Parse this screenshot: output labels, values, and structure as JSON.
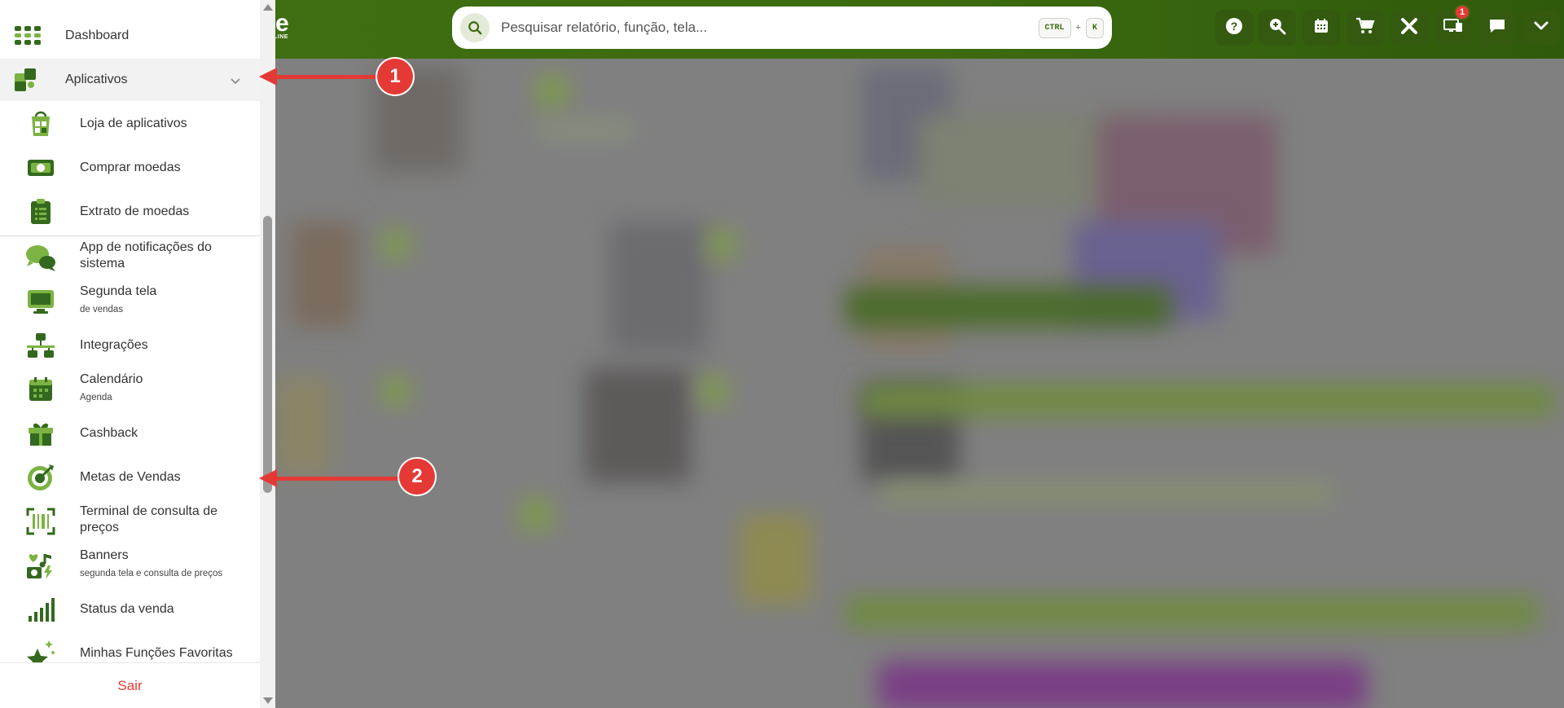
{
  "brand": {
    "logo_letter": "e",
    "logo_sub": "LINE",
    "accent": "#3c6b10",
    "icon_green": "#7cb342",
    "icon_dark": "#33691e",
    "danger": "#e53935"
  },
  "search": {
    "placeholder": "Pesquisar relatório, função, tela...",
    "shortcut_ctrl": "CTRL",
    "shortcut_plus": "+",
    "shortcut_key": "K"
  },
  "topbar_icons": [
    {
      "name": "help-icon"
    },
    {
      "name": "zoom-in-icon"
    },
    {
      "name": "calendar-icon"
    },
    {
      "name": "cart-icon"
    },
    {
      "name": "tools-icon"
    },
    {
      "name": "second-screen-icon",
      "badge": "1"
    },
    {
      "name": "chat-icon"
    },
    {
      "name": "chevron-down-icon"
    }
  ],
  "sidebar": {
    "items": [
      {
        "label": "Dashboard",
        "icon": "grid-icon"
      },
      {
        "label": "Aplicativos",
        "icon": "puzzle-icon",
        "expanded": true
      },
      {
        "label": "Loja de aplicativos",
        "icon": "app-store-icon"
      },
      {
        "label": "Comprar moedas",
        "icon": "money-icon"
      },
      {
        "label": "Extrato de moedas",
        "icon": "clipboard-icon"
      },
      {
        "label": "App de notificações do sistema",
        "icon": "chat-bubbles-icon"
      },
      {
        "label": "Segunda tela",
        "sub": "de vendas",
        "icon": "monitor-icon"
      },
      {
        "label": "Integrações",
        "icon": "network-icon"
      },
      {
        "label": "Calendário",
        "sub": "Agenda",
        "icon": "calendar-icon"
      },
      {
        "label": "Cashback",
        "icon": "gift-icon"
      },
      {
        "label": "Metas de Vendas",
        "icon": "target-icon"
      },
      {
        "label": "Terminal de consulta de preços",
        "icon": "barcode-icon"
      },
      {
        "label": "Banners",
        "sub": "segunda tela e consulta de preços",
        "icon": "media-icon"
      },
      {
        "label": "Status da venda",
        "icon": "signal-bars-icon"
      },
      {
        "label": "Minhas Funções Favoritas",
        "icon": "stars-icon"
      }
    ],
    "logout_label": "Sair"
  },
  "annotations": {
    "marker_1": "1",
    "marker_2": "2"
  }
}
